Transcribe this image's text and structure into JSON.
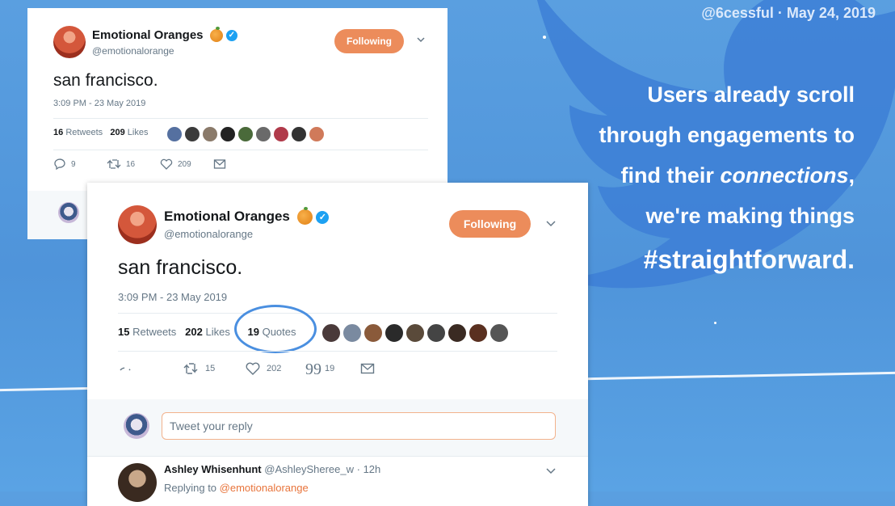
{
  "background": {
    "handle_date": "@6cessful · May 24, 2019",
    "slogan": {
      "line1": "Users already scroll",
      "line2": "through engagements to",
      "line3_pre": "find their ",
      "line3_em": "connections",
      "line3_post": ",",
      "line4": "we're making things",
      "line5": "#straightforward."
    },
    "colors": {
      "bg": "#5a9fe0",
      "bird": "#3d7fd6",
      "text": "#ffffff"
    }
  },
  "card_old": {
    "name": "Emotional Oranges",
    "handle": "@emotionalorange",
    "follow_label": "Following",
    "text": "san francisco.",
    "time": "3:09 PM - 23 May 2019",
    "retweets_count": "16",
    "retweets_label": "Retweets",
    "likes_count": "209",
    "likes_label": "Likes",
    "reply_count": "9",
    "retweet_action_count": "16",
    "like_action_count": "209",
    "icons": [
      "reply-icon",
      "retweet-icon",
      "heart-icon",
      "message-icon",
      "chevron-down-icon",
      "verified-icon",
      "orange-emoji-icon"
    ]
  },
  "card_new": {
    "name": "Emotional Oranges",
    "handle": "@emotionalorange",
    "follow_label": "Following",
    "text": "san francisco.",
    "time": "3:09 PM - 23 May 2019",
    "retweets_count": "15",
    "retweets_label": "Retweets",
    "likes_count": "202",
    "likes_label": "Likes",
    "quotes_count": "19",
    "quotes_label": "Quotes",
    "retweet_action_count": "15",
    "like_action_count": "202",
    "quote_action_count": "19",
    "reply_placeholder": "Tweet your reply",
    "reply": {
      "name": "Ashley Whisenhunt",
      "handle": "@AshleySheree_w",
      "time": "· 12h",
      "replying_prefix": "Replying to",
      "replying_handle": "@emotionalorange"
    },
    "colors": {
      "accent": "#ec8c5b",
      "link": "#e8743b",
      "highlight": "#4a8fe0"
    }
  }
}
